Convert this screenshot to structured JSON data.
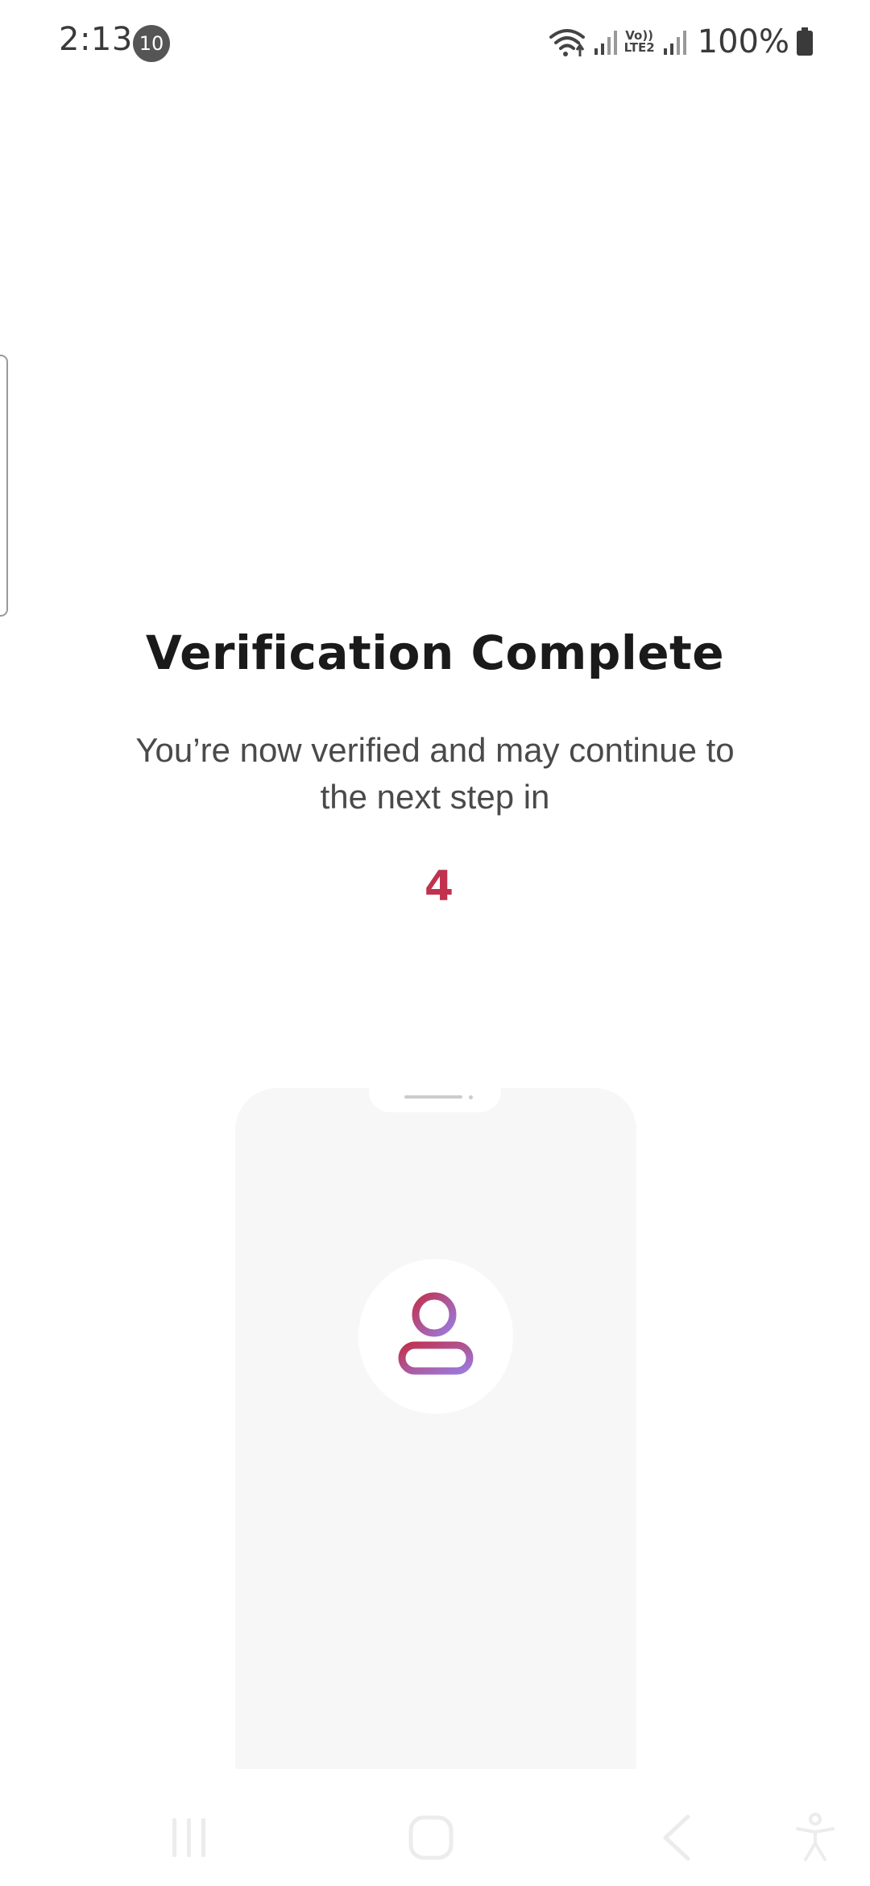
{
  "status_bar": {
    "time": "2:13",
    "notification_count": "10",
    "network_label": "Vo)) LTE2",
    "battery_percent": "100%"
  },
  "content": {
    "title": "Verification Complete",
    "message": "You’re now verified and may continue to the next step in",
    "countdown": "4"
  },
  "illustration": {
    "icon": "user-profile-icon",
    "gradient_start": "#c0324f",
    "gradient_end": "#9a7be0"
  },
  "nav_bar": {
    "buttons": [
      "recent-apps-icon",
      "home-icon",
      "back-icon",
      "accessibility-icon"
    ]
  }
}
